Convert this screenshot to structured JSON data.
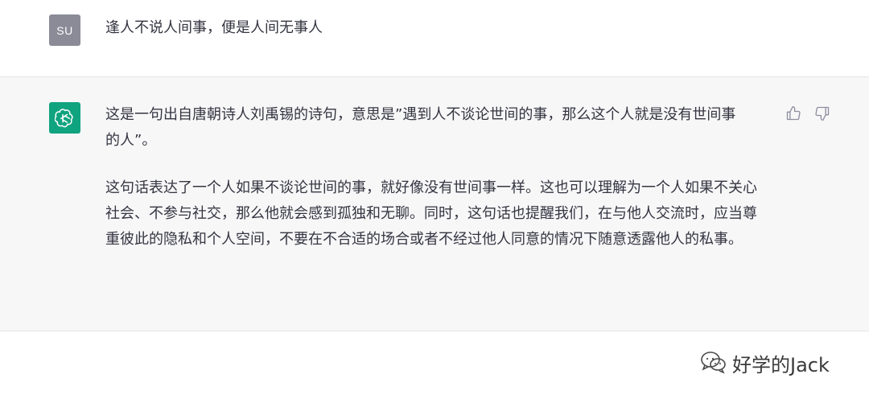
{
  "user_message": {
    "avatar_initials": "SU",
    "text": "逢人不说人间事，便是人间无事人"
  },
  "assistant_message": {
    "avatar_icon": "openai-logo-icon",
    "paragraphs": [
      "这是一句出自唐朝诗人刘禹锡的诗句，意思是”遇到人不谈论世间的事，那么这个人就是没有世间事的人”。",
      "这句话表达了一个人如果不谈论世间的事，就好像没有世间事一样。这也可以理解为一个人如果不关心社会、不参与社交，那么他就会感到孤独和无聊。同时，这句话也提醒我们，在与他人交流时，应当尊重彼此的隐私和个人空间，不要在不合适的场合或者不经过他人同意的情况下随意透露他人的私事。"
    ],
    "feedback": {
      "thumbs_up_icon": "thumbs-up-icon",
      "thumbs_down_icon": "thumbs-down-icon"
    }
  },
  "watermark": {
    "icon": "wechat-icon",
    "text": "好学的Jack"
  },
  "colors": {
    "assistant_bg": "#f7f7f8",
    "user_avatar_bg": "#8a8b97",
    "bot_avatar_bg": "#10a37f",
    "text": "#343541"
  }
}
